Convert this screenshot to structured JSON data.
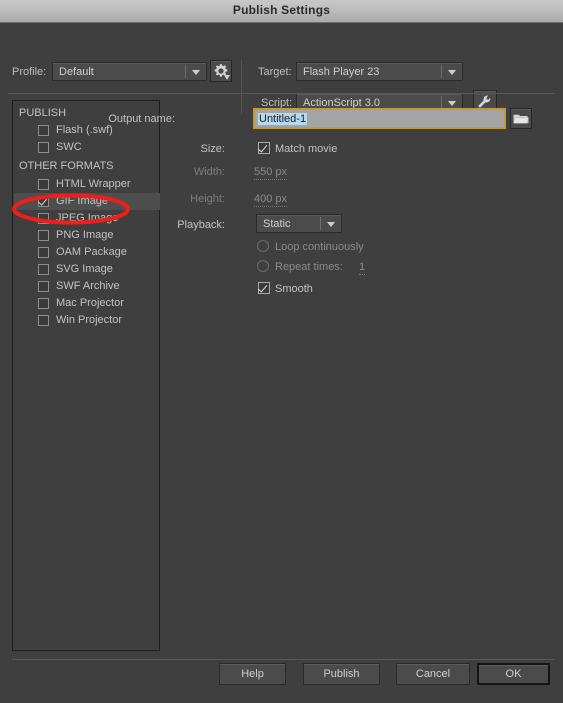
{
  "window": {
    "title": "Publish Settings"
  },
  "header": {
    "profile_label": "Profile:",
    "profile_value": "Default",
    "gear_icon": "gear-icon",
    "target_label": "Target:",
    "target_value": "Flash Player 23",
    "script_label": "Script:",
    "script_value": "ActionScript 3.0",
    "wrench_icon": "wrench-icon"
  },
  "formats": {
    "groups": [
      {
        "heading": "PUBLISH",
        "items": [
          {
            "label": "Flash (.swf)",
            "checked": false,
            "selected": false
          },
          {
            "label": "SWC",
            "checked": false,
            "selected": false
          }
        ]
      },
      {
        "heading": "OTHER FORMATS",
        "items": [
          {
            "label": "HTML Wrapper",
            "checked": false,
            "selected": false
          },
          {
            "label": "GIF Image",
            "checked": true,
            "selected": true
          },
          {
            "label": "JPEG Image",
            "checked": false,
            "selected": false
          },
          {
            "label": "PNG Image",
            "checked": false,
            "selected": false
          },
          {
            "label": "OAM Package",
            "checked": false,
            "selected": false
          },
          {
            "label": "SVG Image",
            "checked": false,
            "selected": false
          },
          {
            "label": "SWF Archive",
            "checked": false,
            "selected": false
          },
          {
            "label": "Mac Projector",
            "checked": false,
            "selected": false
          },
          {
            "label": "Win Projector",
            "checked": false,
            "selected": false
          }
        ]
      }
    ]
  },
  "settings": {
    "output_name_label": "Output name:",
    "output_name_value": "Untitled-1",
    "browse_icon": "folder-icon",
    "size_label": "Size:",
    "match_movie_label": "Match movie",
    "width_label": "Width:",
    "width_value": "550 px",
    "height_label": "Height:",
    "height_value": "400 px",
    "playback_label": "Playback:",
    "playback_value": "Static",
    "loop_label": "Loop continuously",
    "repeat_label": "Repeat times:",
    "repeat_value": "1",
    "smooth_label": "Smooth"
  },
  "footer": {
    "help": "Help",
    "publish": "Publish",
    "cancel": "Cancel",
    "ok": "OK"
  },
  "annotation": {
    "color": "#f01d1d",
    "shape": "ellipse-highlight"
  }
}
